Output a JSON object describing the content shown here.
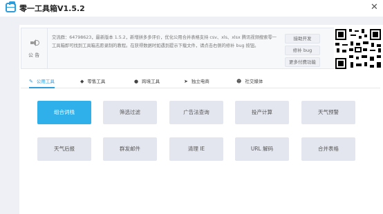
{
  "window": {
    "title": "零一工具箱V1.5.2",
    "close_label": "✕"
  },
  "notice": {
    "label": "公 告",
    "text": "交流群：64798623，最新版本 1.5.2，新增拼多多评价，优化公用合并表格支持 csv、xls、xlsx 腾讯视频搜索零一工具箱即可找到工具箱志愿录制的教程。在获得数据时如遇到提示下载文件，请点击右侧的修补 bug 按钮。",
    "buttons": [
      "接助开发",
      "修补 bug",
      "更多付费功能"
    ]
  },
  "tabs": [
    {
      "icon": "wrench-icon",
      "glyph": "✎",
      "label": "公用工具"
    },
    {
      "icon": "tag-icon",
      "glyph": "◆",
      "label": "零售工具"
    },
    {
      "icon": "pin-icon",
      "glyph": "●",
      "label": "跨境工具"
    },
    {
      "icon": "send-icon",
      "glyph": "➤",
      "label": "独立电商"
    },
    {
      "icon": "chat-icon",
      "glyph": "☻",
      "label": "社交媒体"
    }
  ],
  "tools": [
    "组合词栈",
    "筛选过滤",
    "广告法查询",
    "投产计算",
    "天气预警",
    "天气后报",
    "群发邮件",
    "清理 IE",
    "URL 解码",
    "合并表格"
  ],
  "colors": {
    "accent": "#2fb0ea",
    "tab_active": "#2d9cdb",
    "button_bg": "#e4e6ef",
    "page_bg": "#eef0f5"
  }
}
